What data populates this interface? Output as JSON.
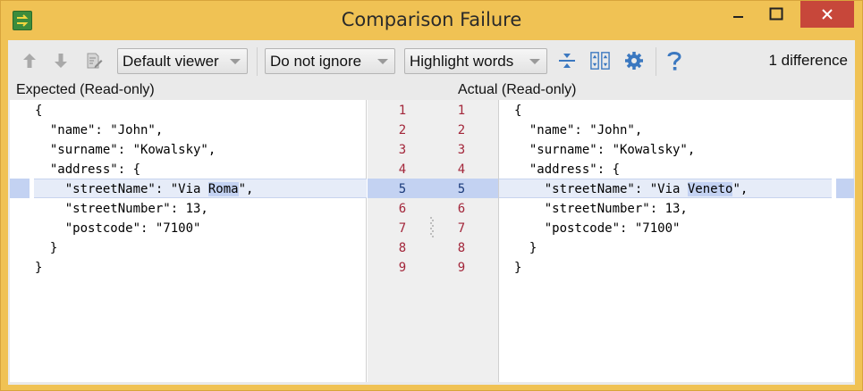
{
  "window": {
    "title": "Comparison Failure"
  },
  "toolbar": {
    "viewer_combo": "Default viewer",
    "ignore_combo": "Do not ignore",
    "highlight_combo": "Highlight words",
    "difference_count": "1 difference"
  },
  "left_pane": {
    "label": "Expected (Read-only)",
    "lines": [
      "{",
      "  \"name\": \"John\",",
      "  \"surname\": \"Kowalsky\",",
      "  \"address\": {",
      "    \"streetNumber\": 13,",
      "    \"postcode\": \"7100\"",
      "  }",
      "}"
    ],
    "changed_line": {
      "before": "    \"streetName\": \"Via ",
      "changed": "Roma",
      "after": "\","
    }
  },
  "right_pane": {
    "label": "Actual (Read-only)",
    "lines": [
      "{",
      "  \"name\": \"John\",",
      "  \"surname\": \"Kowalsky\",",
      "  \"address\": {",
      "    \"streetNumber\": 13,",
      "    \"postcode\": \"7100\"",
      "  }",
      "}"
    ],
    "changed_line": {
      "before": "    \"streetName\": \"Via ",
      "changed": "Veneto",
      "after": "\","
    }
  },
  "gutter": {
    "left_numbers": [
      "1",
      "2",
      "3",
      "4",
      "5",
      "6",
      "7",
      "8",
      "9"
    ],
    "right_numbers": [
      "1",
      "2",
      "3",
      "4",
      "5",
      "6",
      "7",
      "8",
      "9"
    ]
  },
  "icons": {
    "app": "compare-arrows-icon",
    "prev_diff": "arrow-up-icon",
    "next_diff": "arrow-down-icon",
    "edit_source": "edit-source-icon",
    "collapse": "collapse-unchanged-icon",
    "sync_scroll": "sync-scroll-icon",
    "settings": "gear-icon",
    "help": "help-icon"
  },
  "colors": {
    "title_bar": "#f0c254",
    "close_button": "#c7473a",
    "changed_line_bg": "#e6ecf8",
    "changed_word_bg": "#c3d2f2",
    "line_number": "#a3263a"
  }
}
